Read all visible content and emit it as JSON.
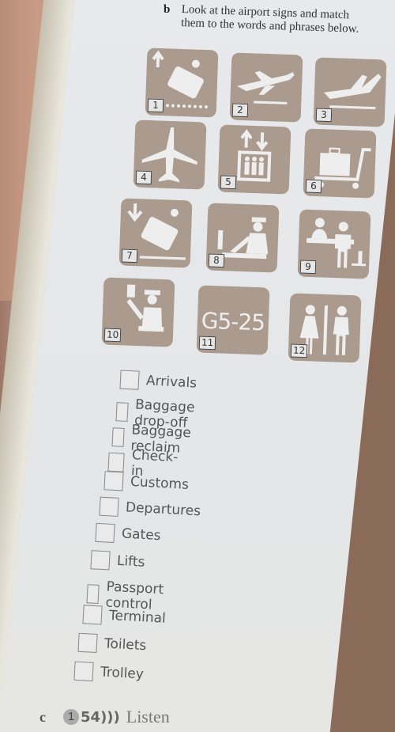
{
  "exercise_b": {
    "letter": "b",
    "instruction": "Look at the airport signs and match them to the words and phrases below."
  },
  "signs": [
    {
      "number": "1",
      "icon": "baggage-drop-off-sign-icon"
    },
    {
      "number": "2",
      "icon": "departures-plane-icon"
    },
    {
      "number": "3",
      "icon": "arrivals-plane-icon"
    },
    {
      "number": "4",
      "icon": "terminal-plane-icon"
    },
    {
      "number": "5",
      "icon": "lift-icon"
    },
    {
      "number": "6",
      "icon": "trolley-icon"
    },
    {
      "number": "7",
      "icon": "baggage-reclaim-icon"
    },
    {
      "number": "8",
      "icon": "customs-officer-icon"
    },
    {
      "number": "9",
      "icon": "check-in-desk-icon"
    },
    {
      "number": "10",
      "icon": "passport-control-icon"
    },
    {
      "number": "11",
      "icon": "gates-icon",
      "text": "G5-25"
    },
    {
      "number": "12",
      "icon": "toilets-icon"
    }
  ],
  "options": [
    "Arrivals",
    "Baggage drop-off",
    "Baggage reclaim",
    "Check-in",
    "Customs",
    "Departures",
    "Gates",
    "Lifts",
    "Passport control",
    "Terminal",
    "Toilets",
    "Trolley"
  ],
  "exercise_c": {
    "letter": "c",
    "cd": "1",
    "track": "54",
    "text": "Listen"
  },
  "colors": {
    "sign_bg": "#aa9b8e",
    "page_bg": "#e6e7e9"
  }
}
